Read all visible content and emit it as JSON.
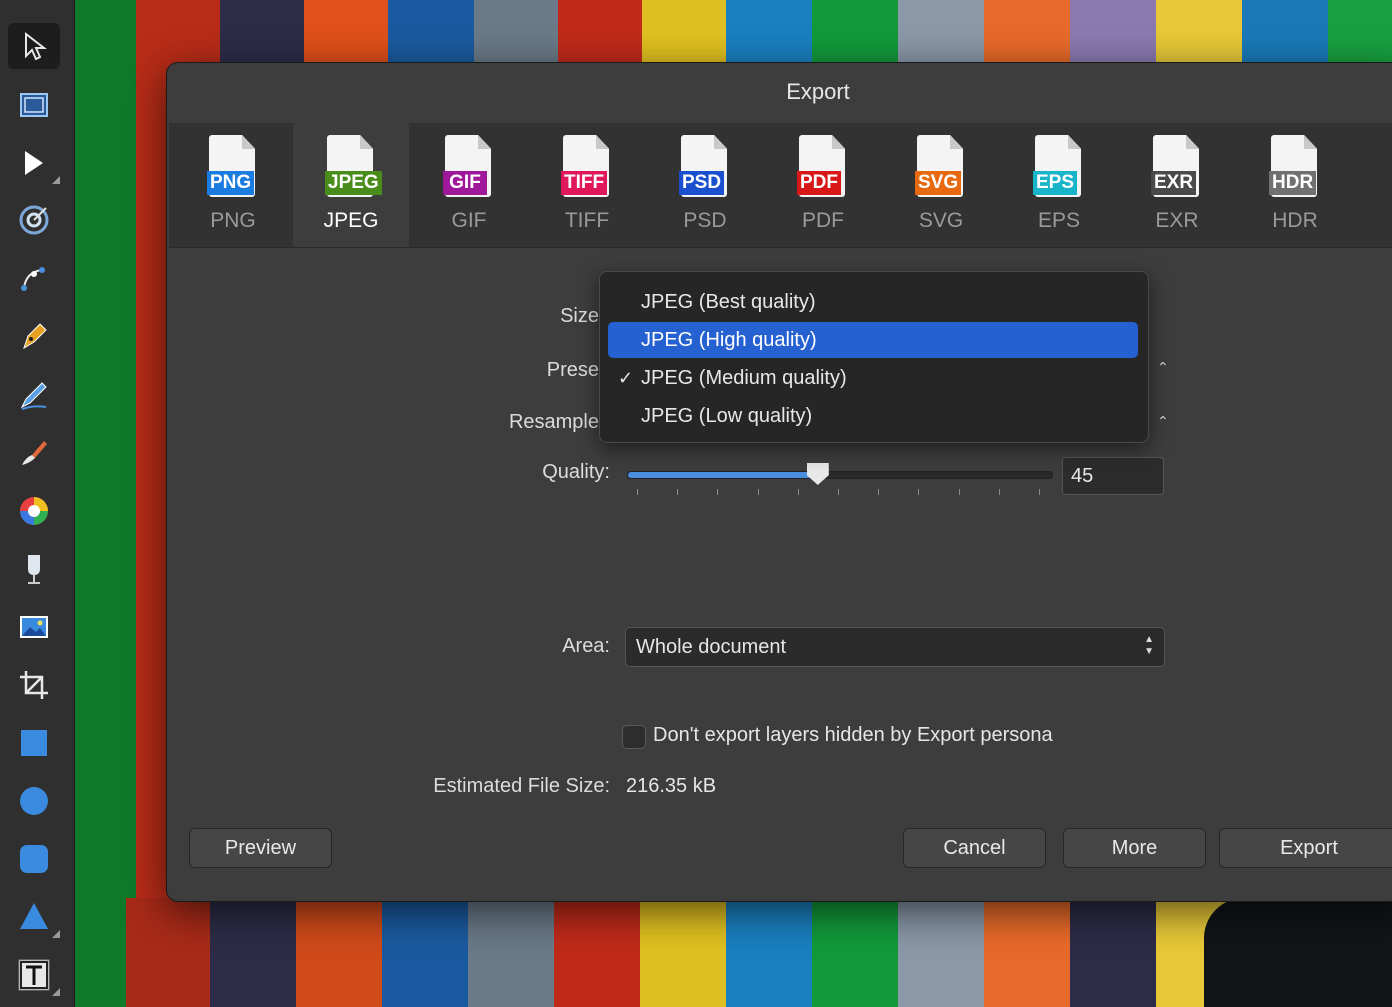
{
  "dialog": {
    "title": "Export"
  },
  "formats": [
    {
      "tag": "PNG",
      "label": "PNG",
      "color": "#1a7be0",
      "selected": false
    },
    {
      "tag": "JPEG",
      "label": "JPEG",
      "color": "#4a8c1c",
      "selected": true
    },
    {
      "tag": "GIF",
      "label": "GIF",
      "color": "#a0189a",
      "selected": false
    },
    {
      "tag": "TIFF",
      "label": "TIFF",
      "color": "#e0185a",
      "selected": false
    },
    {
      "tag": "PSD",
      "label": "PSD",
      "color": "#1a4fcf",
      "selected": false
    },
    {
      "tag": "PDF",
      "label": "PDF",
      "color": "#d81818",
      "selected": false
    },
    {
      "tag": "SVG",
      "label": "SVG",
      "color": "#e86a10",
      "selected": false
    },
    {
      "tag": "EPS",
      "label": "EPS",
      "color": "#18b4c8",
      "selected": false
    },
    {
      "tag": "EXR",
      "label": "EXR",
      "color": "#4a4a4a",
      "selected": false
    },
    {
      "tag": "HDR",
      "label": "HDR",
      "color": "#707070",
      "selected": false
    }
  ],
  "form": {
    "size_label": "Size",
    "preset_label": "Prese",
    "resample_label": "Resample",
    "quality_label": "Quality:",
    "quality_value": "45",
    "quality_fraction": 0.45,
    "area_label": "Area:",
    "area_value": "Whole document",
    "hidden_layers_label": "Don't export layers hidden by Export persona",
    "hidden_layers_checked": false,
    "filesize_label": "Estimated File Size:",
    "filesize_value": "216.35 kB"
  },
  "preset_menu": {
    "items": [
      {
        "label": "JPEG (Best quality)",
        "highlighted": false,
        "checked": false
      },
      {
        "label": "JPEG (High quality)",
        "highlighted": true,
        "checked": false
      },
      {
        "label": "JPEG (Medium quality)",
        "highlighted": false,
        "checked": true
      },
      {
        "label": "JPEG (Low quality)",
        "highlighted": false,
        "checked": false
      }
    ],
    "check_mark": "✓"
  },
  "buttons": {
    "preview": "Preview",
    "cancel": "Cancel",
    "more": "More",
    "export": "Export"
  },
  "toolbar": {
    "tools": [
      "move-tool-icon",
      "artboard-tool-icon",
      "node-tool-icon",
      "context-tool-icon",
      "corner-tool-icon",
      "pen-tool-icon",
      "pencil-tool-icon",
      "vector-brush-icon",
      "fill-tool-icon",
      "transparency-tool-icon",
      "place-image-icon",
      "crop-tool-icon",
      "rectangle-tool-icon",
      "ellipse-tool-icon",
      "rounded-rectangle-icon",
      "triangle-tool-icon",
      "text-tool-icon"
    ]
  },
  "colors": {
    "accent": "#2561d0",
    "slider_fill": "#4a8fe0",
    "background_stripes": [
      "#0e7a2a",
      "#c0301a",
      "#2c2c48",
      "#e0501a",
      "#1a5aa0",
      "#6a7a88",
      "#c02a1a",
      "#e0c020",
      "#1a80c0",
      "#129a3a",
      "#8a98a8",
      "#e86a2a",
      "#8a7ab0",
      "#e8c838",
      "#1a7ab8",
      "#18a040"
    ]
  }
}
